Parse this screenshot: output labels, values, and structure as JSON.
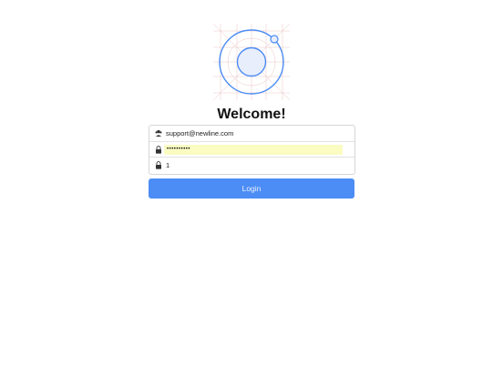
{
  "logo": {
    "icon": "ionic-logo-icon",
    "accent": "#4c8df5"
  },
  "title": "Welcome!",
  "form": {
    "email": {
      "icon": "user-icon",
      "value": "support@newline.com"
    },
    "password": {
      "icon": "lock-icon",
      "masked_value": "••••••••••",
      "autofill_color": "#fafcc2"
    },
    "third": {
      "icon": "lock-icon",
      "value": "1"
    }
  },
  "login_button": {
    "label": "Login",
    "color": "#4c8df5"
  }
}
